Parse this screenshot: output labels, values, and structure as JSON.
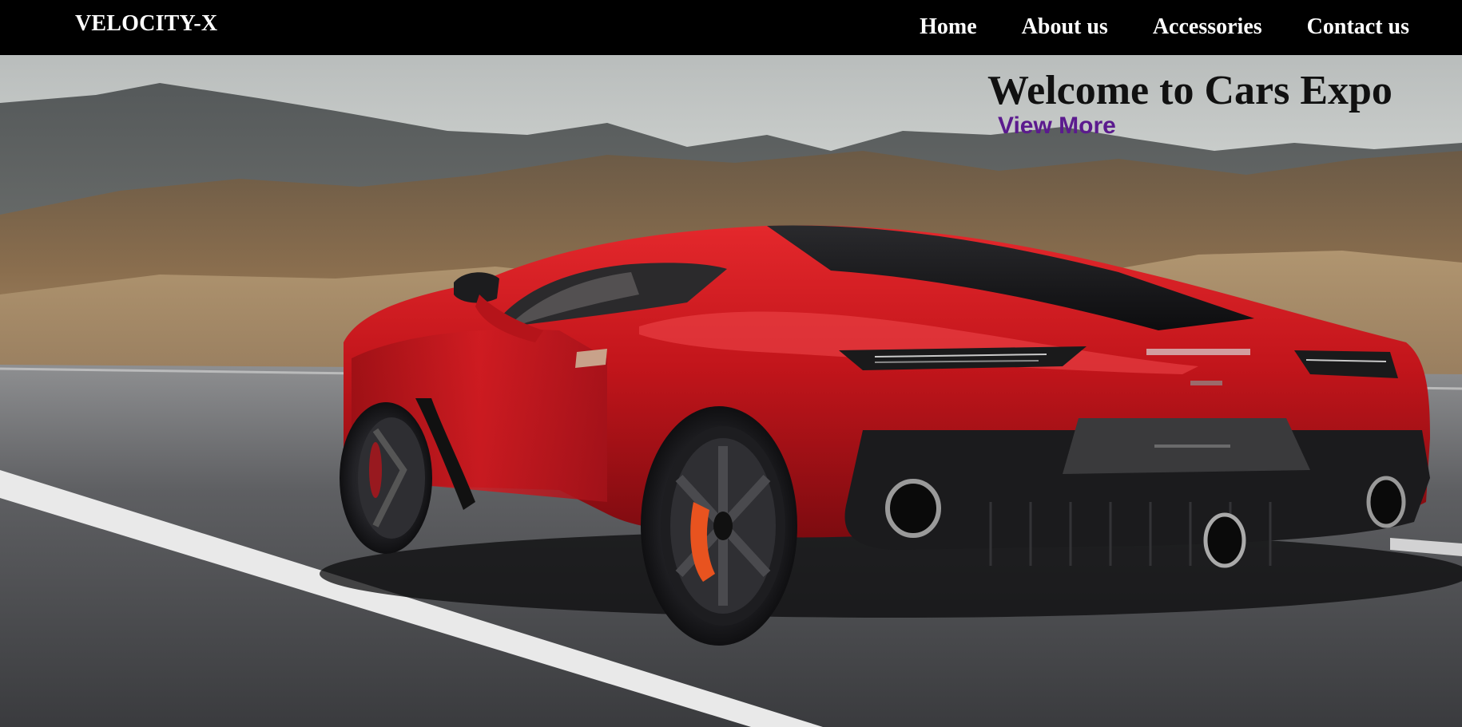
{
  "nav": {
    "brand": "VELOCITY-X",
    "links": [
      "Home",
      "About us",
      "Accessories",
      "Contact us"
    ]
  },
  "hero": {
    "title": "Welcome to Cars Expo",
    "cta": "View More",
    "image": "red sports car on highway with mountains background"
  },
  "colors": {
    "nav_bg": "#000000",
    "nav_text": "#ffffff",
    "title_text": "#111111",
    "cta_link": "#5b1a8e",
    "car_red": "#c2151b"
  }
}
